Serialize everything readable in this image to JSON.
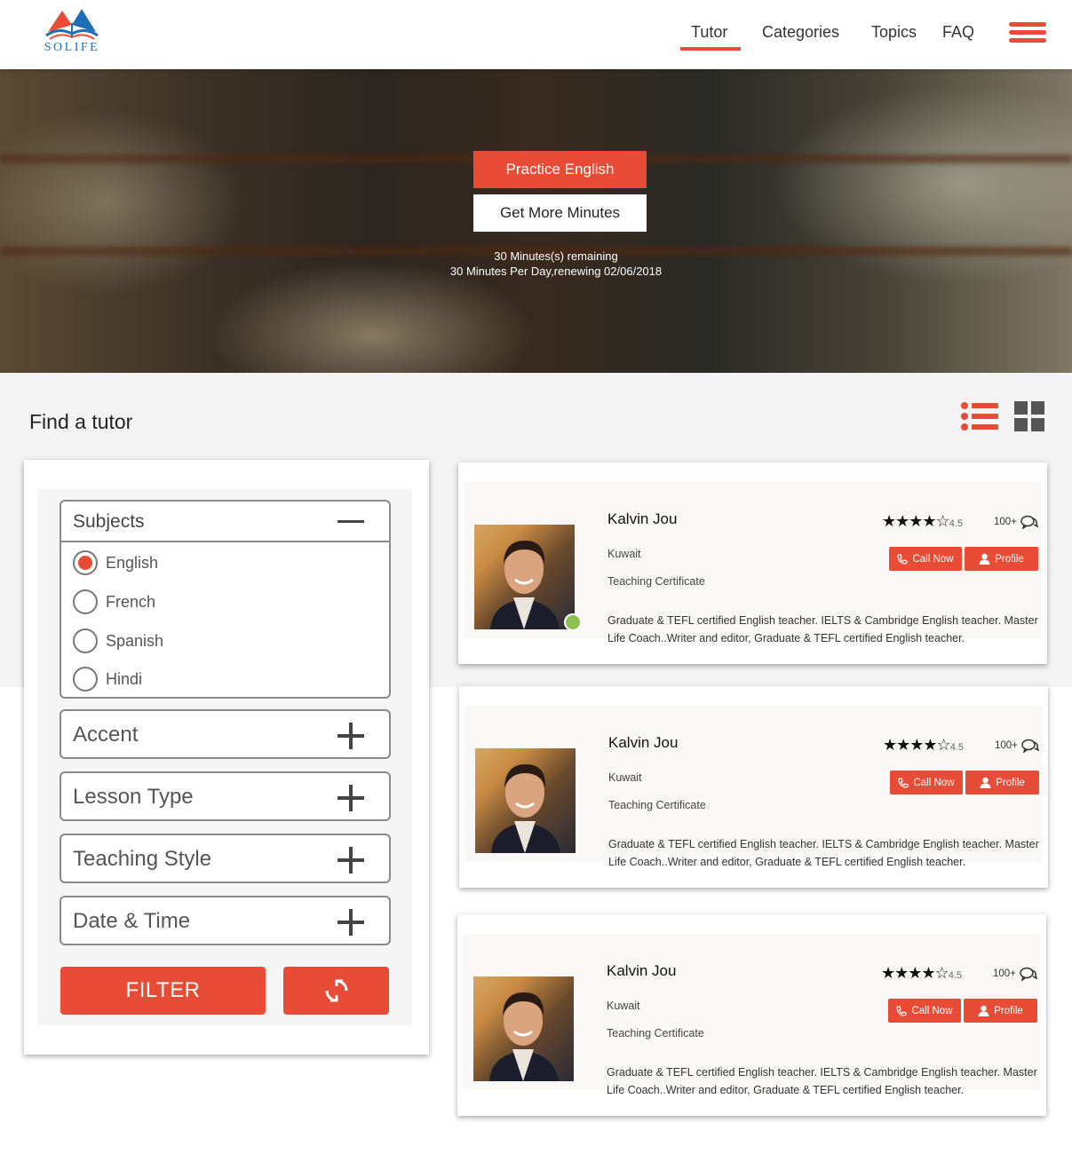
{
  "header": {
    "logo_text": "SOLIFE",
    "nav": [
      "Tutor",
      "Categories",
      "Topics",
      "FAQ"
    ],
    "active_nav": "Tutor"
  },
  "hero": {
    "practice_label": "Practice English",
    "minutes_label": "Get More Minutes",
    "remaining_text": "30 Minutes(s) remaining",
    "renew_text": "30 Minutes Per Day,renewing 02/06/2018"
  },
  "main": {
    "title": "Find a tutor"
  },
  "filters": {
    "subjects_title": "Subjects",
    "subjects": [
      "English",
      "French",
      "Spanish",
      "Hindi"
    ],
    "selected_subject": "English",
    "accordions": [
      "Accent",
      "Lesson Type",
      "Teaching Style",
      "Date & Time"
    ],
    "filter_label": "FILTER"
  },
  "tutors": [
    {
      "name": "Kalvin Jou",
      "location": "Kuwait",
      "certificate": "Teaching Certificate",
      "rating": "4.5",
      "reviews": "100+",
      "call_label": "Call Now",
      "profile_label": "Profile",
      "online": true,
      "description": "Graduate & TEFL certified English teacher. IELTS &  Cambridge English teacher. Master Life Coach..Writer and editor, Graduate & TEFL certified English teacher."
    },
    {
      "name": "Kalvin Jou",
      "location": "Kuwait",
      "certificate": "Teaching Certificate",
      "rating": "4.5",
      "reviews": "100+",
      "call_label": "Call Now",
      "profile_label": "Profile",
      "online": false,
      "description": "Graduate & TEFL certified English teacher. IELTS &  Cambridge English teacher. Master Life Coach..Writer and editor, Graduate & TEFL certified English teacher."
    },
    {
      "name": "Kalvin Jou",
      "location": "Kuwait",
      "certificate": "Teaching Certificate",
      "rating": "4.5",
      "reviews": "100+",
      "call_label": "Call Now",
      "profile_label": "Profile",
      "online": false,
      "description": "Graduate & TEFL certified English teacher. IELTS &  Cambridge English teacher. Master Life Coach..Writer and editor, Graduate & TEFL certified English teacher."
    }
  ],
  "colors": {
    "accent": "#e84c36",
    "online": "#8cc152",
    "logo_blue": "#1f6fb5"
  }
}
